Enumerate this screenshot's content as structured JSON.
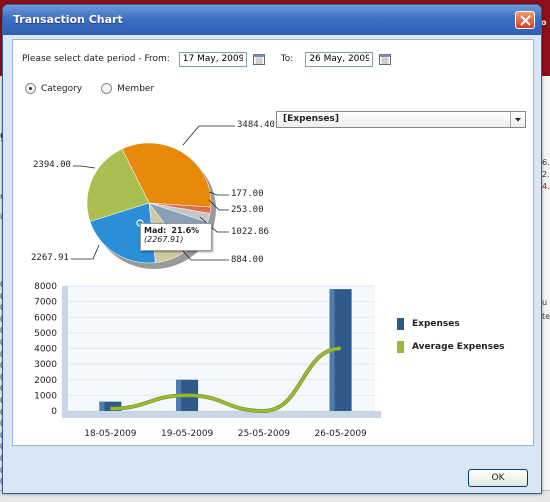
{
  "dialog": {
    "title": "Transaction Chart",
    "ok_label": "OK"
  },
  "date_filter": {
    "label_from": "Please select date period - From:",
    "from_value": "17 May, 2009",
    "label_to": "To:",
    "to_value": "26 May, 2009"
  },
  "mode": {
    "options": [
      "Category",
      "Member"
    ],
    "selected": "Category"
  },
  "series_select": {
    "value": "[Expenses]"
  },
  "pie": {
    "values": [
      {
        "value": "3484.40",
        "color": "#e8890c"
      },
      {
        "value": "177.00",
        "color": "#e06a4a"
      },
      {
        "value": "253.00",
        "color": "#c6c6c6"
      },
      {
        "value": "1022.86",
        "color": "#8aa0b8"
      },
      {
        "value": "884.00",
        "color": "#cfcba0"
      },
      {
        "value": "2267.91",
        "color": "#2a8fd8"
      },
      {
        "value": "2394.00",
        "color": "#a9c050"
      }
    ],
    "tooltip": {
      "name": "Mad:",
      "percent": "21.6%",
      "value": "(2267.91)"
    }
  },
  "chart_data": {
    "type": "bar",
    "categories": [
      "18-05-2009",
      "19-05-2009",
      "25-05-2009",
      "26-05-2009"
    ],
    "series": [
      {
        "name": "Expenses",
        "values": [
          600,
          2000,
          0,
          7800
        ],
        "color": "#2e5a8a"
      },
      {
        "name": "Average Expenses",
        "values": [
          150,
          1000,
          0,
          4000
        ],
        "color": "#9ab93a"
      }
    ],
    "ylim": [
      0,
      8000
    ],
    "yticks": [
      "0",
      "1000",
      "2000",
      "3000",
      "4000",
      "5000",
      "6000",
      "7000",
      "8000"
    ],
    "grid": true,
    "legend": "right"
  },
  "background": {
    "left_fragments": [
      "ge",
      "rio",
      "int",
      "009",
      "009",
      "009",
      "009",
      "009",
      "009",
      "009",
      "009",
      "009",
      "009",
      "009",
      "009",
      "009",
      "009",
      "009",
      "009",
      "009",
      "009"
    ],
    "right_fragments": [
      "Jo",
      "6.",
      "2.",
      "4.",
      "u",
      "tel"
    ]
  }
}
